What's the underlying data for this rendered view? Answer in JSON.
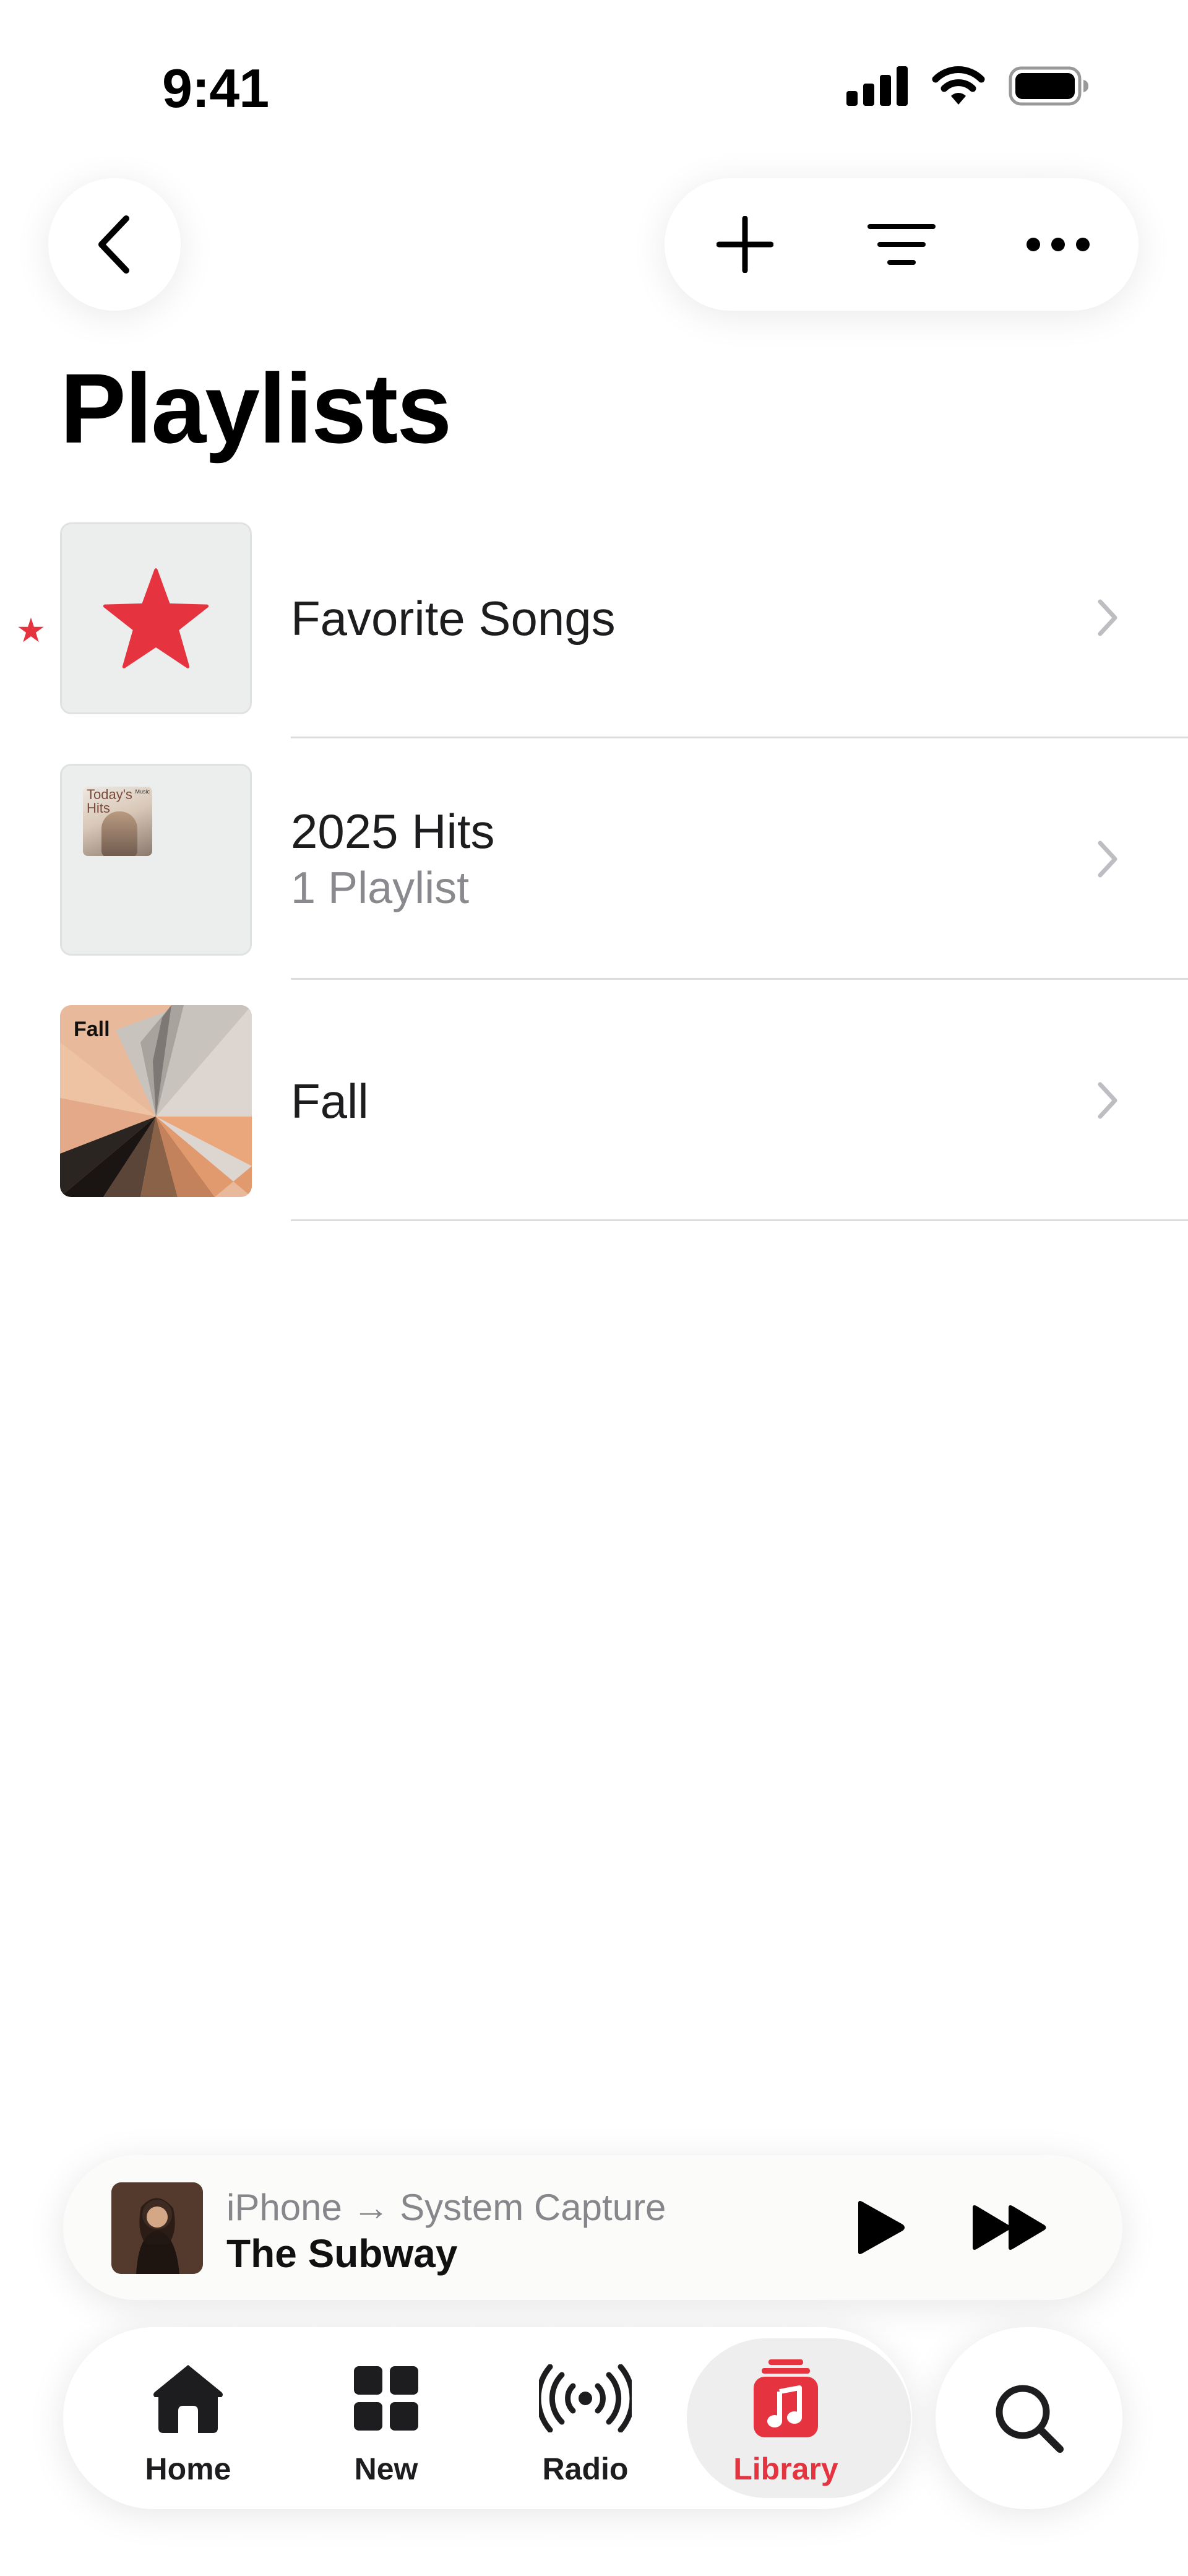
{
  "status_bar": {
    "time": "9:41"
  },
  "header": {
    "title": "Playlists"
  },
  "playlists": [
    {
      "title": "Favorite Songs",
      "subtitle": ""
    },
    {
      "title": "2025 Hits",
      "subtitle": "1 Playlist",
      "art_text_1": "Today's",
      "art_text_2": "Hits",
      "art_badge": "Music"
    },
    {
      "title": "Fall",
      "subtitle": "",
      "art_text": "Fall"
    }
  ],
  "mini_player": {
    "route": "iPhone → System Capture",
    "title": "The Subway"
  },
  "tab_bar": {
    "tabs": [
      {
        "label": "Home",
        "icon": "house-icon"
      },
      {
        "label": "New",
        "icon": "grid-icon"
      },
      {
        "label": "Radio",
        "icon": "radio-waves-icon"
      },
      {
        "label": "Library",
        "icon": "music-library-icon",
        "active": true
      }
    ],
    "search_icon": "magnifying-glass-icon"
  },
  "colors": {
    "accent": "#e5333f",
    "background": "#ffffff",
    "secondary_text": "#8a8a8e"
  }
}
